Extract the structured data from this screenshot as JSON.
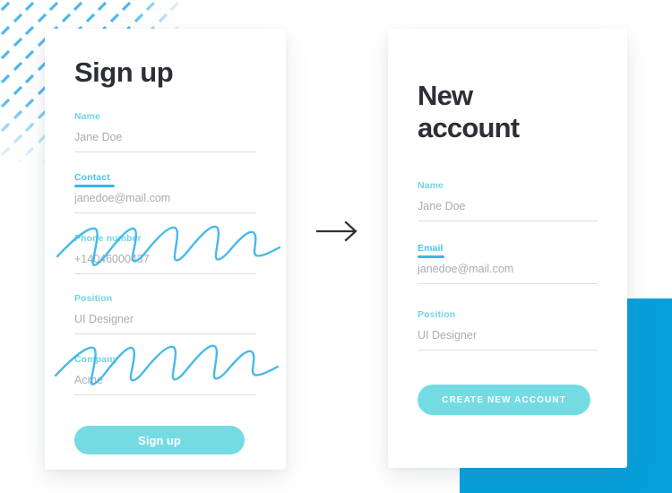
{
  "theme": {
    "accent_teal": "#74dbe3",
    "accent_blue": "#37b6e9",
    "pattern_blue": "#4cb9ef",
    "block_blue": "#059fdb",
    "label_teal": "#6fd6e2",
    "text_dark": "#2c2f36",
    "placeholder_gray": "#a8acb1"
  },
  "signup_card": {
    "title": "Sign up",
    "fields": [
      {
        "label": "Name",
        "value": "Jane Doe",
        "underlined": false,
        "scribbled": false
      },
      {
        "label": "Contact",
        "value": "janedoe@mail.com",
        "underlined": true,
        "scribbled": false
      },
      {
        "label": "Phone number",
        "value": "+14046000437",
        "underlined": false,
        "scribbled": true
      },
      {
        "label": "Position",
        "value": "UI Designer",
        "underlined": false,
        "scribbled": false
      },
      {
        "label": "Company",
        "value": "Acme",
        "underlined": false,
        "scribbled": true
      }
    ],
    "submit_label": "Sign up"
  },
  "new_account_card": {
    "title": "New account",
    "title_line_1": "New",
    "title_line_2": "account",
    "fields": [
      {
        "label": "Name",
        "value": "Jane Doe",
        "underlined": false
      },
      {
        "label": "Email",
        "value": "janedoe@mail.com",
        "underlined": true
      },
      {
        "label": "Position",
        "value": "UI Designer",
        "underlined": false
      }
    ],
    "submit_label": "CREATE NEW ACCOUNT"
  },
  "decoration": {
    "arrow_icon": "arrow-right-icon",
    "pattern_icon": "diagonal-dash-pattern",
    "accent_block_icon": "blue-accent-block",
    "scribble_icon": "scribble-strikeout"
  }
}
